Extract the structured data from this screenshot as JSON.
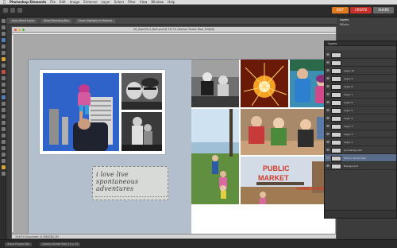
{
  "menubar": {
    "app_name": "Photoshop Elements",
    "items": [
      "File",
      "Edit",
      "Image",
      "Enhance",
      "Layer",
      "Select",
      "Filter",
      "View",
      "Window",
      "Help"
    ]
  },
  "mode_tabs": {
    "edit": "EDIT",
    "create": "CREATE",
    "share": "SHARE"
  },
  "options_bar": {
    "items": [
      "Auto Select Layer",
      "Show Bounding Box",
      "Show Highlight on Rollover"
    ]
  },
  "document": {
    "title": "08_Sept2011_Bolt.psd @ 16.7% (Harbor Street Wall, RGB/8)",
    "status": "16.67%    Document: 6.30M/264.2M"
  },
  "panel_top": {
    "rows": [
      "Layers",
      "Effects"
    ]
  },
  "layers_panel": {
    "header": "Layers",
    "rows": [
      {
        "label": "",
        "selected": false
      },
      {
        "label": "",
        "selected": false
      },
      {
        "label": "Layer 10",
        "selected": false
      },
      {
        "label": "Layer 9",
        "selected": false
      },
      {
        "label": "Layer 8",
        "selected": false
      },
      {
        "label": "Layer 7",
        "selected": false
      },
      {
        "label": "Layer 6",
        "selected": false
      },
      {
        "label": "Layer 5",
        "selected": false
      },
      {
        "label": "Layer 4",
        "selected": false
      },
      {
        "label": "Layer 3",
        "selected": false
      },
      {
        "label": "Layer 2",
        "selected": false
      },
      {
        "label": "Layer 1",
        "selected": false
      },
      {
        "label": "Journaling Card",
        "selected": false
      },
      {
        "label": "Harbor Street Wall",
        "selected": true
      },
      {
        "label": "Background",
        "selected": false
      }
    ]
  },
  "journal_card": {
    "text": "i love live spontaneous adventures"
  },
  "bottombar": {
    "items": [
      "Show Project Bin",
      "Harbor Street Wall 10 x 10"
    ]
  },
  "colors": {
    "accent_edit": "#e07a1f",
    "accent_create": "#c8302b",
    "layer_selected": "#596d8a"
  }
}
